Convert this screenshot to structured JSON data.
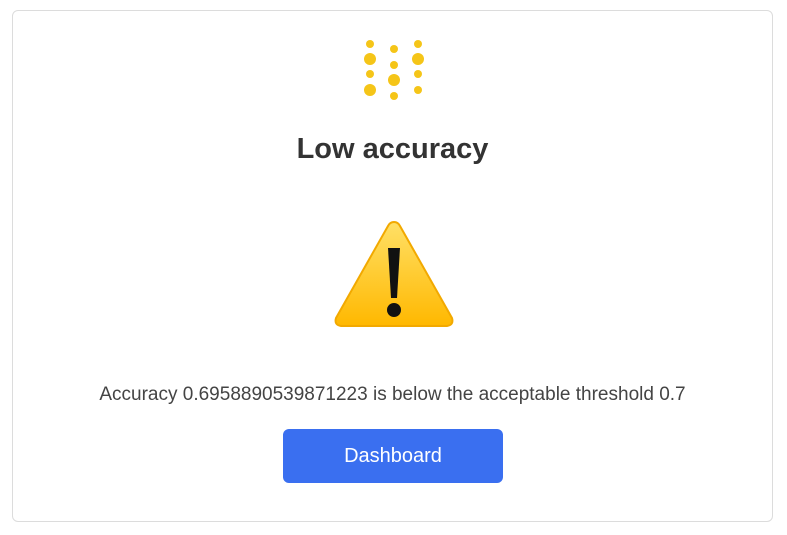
{
  "title": "Low accuracy",
  "message": "Accuracy 0.6958890539871223 is below the acceptable threshold 0.7",
  "button_label": "Dashboard",
  "icons": {
    "logo": "dotted-logo-icon",
    "warning": "warning-icon"
  },
  "colors": {
    "logo_dots": "#f5c518",
    "button_bg": "#3a6ff0",
    "warning_fill": "#ffc400"
  }
}
